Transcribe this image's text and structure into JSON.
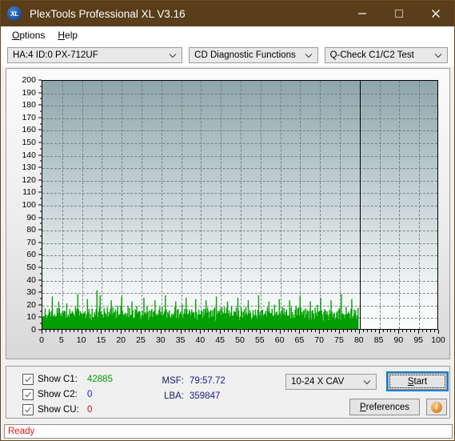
{
  "window": {
    "title": "PlexTools Professional XL V3.16",
    "icon": "XL",
    "icon_name": "plextools-logo-icon",
    "titlebar_color": "#5a3d1a",
    "controls": {
      "minimize": "minimize-icon",
      "maximize": "maximize-icon",
      "close": "close-icon"
    }
  },
  "menubar": {
    "items": [
      {
        "label": "Options",
        "accel": "O"
      },
      {
        "label": "Help",
        "accel": "H"
      }
    ]
  },
  "selectors": {
    "drive": {
      "value": "HA:4 ID:0  PX-712UF"
    },
    "function": {
      "value": "CD Diagnostic Functions"
    },
    "test": {
      "value": "Q-Check C1/C2 Test"
    }
  },
  "chart_data": {
    "type": "area",
    "title": "",
    "xlabel": "",
    "ylabel": "",
    "xlim": [
      0,
      100
    ],
    "ylim": [
      0,
      200
    ],
    "xticks": [
      0,
      5,
      10,
      15,
      20,
      25,
      30,
      35,
      40,
      45,
      50,
      55,
      60,
      65,
      70,
      75,
      80,
      85,
      90,
      95,
      100
    ],
    "yticks": [
      0,
      10,
      20,
      30,
      40,
      50,
      60,
      70,
      80,
      90,
      100,
      110,
      120,
      130,
      140,
      150,
      160,
      170,
      180,
      190,
      200
    ],
    "grid": true,
    "legend": null,
    "data_end_x": 80,
    "series": [
      {
        "name": "C1",
        "color": "#00a000",
        "baseline": 0,
        "x_start": 0,
        "x_end": 80,
        "y_mean": 14,
        "y_min": 6,
        "y_max": 31,
        "values": [
          8,
          11,
          9,
          13,
          10,
          7,
          12,
          9,
          14,
          11,
          8,
          15,
          10,
          12,
          9,
          13,
          11,
          8,
          14,
          10,
          12,
          16,
          9,
          13,
          11,
          15,
          10,
          12,
          14,
          9,
          18,
          11,
          13,
          10,
          16,
          12,
          9,
          14,
          11,
          13,
          10,
          15,
          12,
          17,
          11,
          13,
          9,
          16,
          12,
          14,
          10,
          13,
          11,
          15,
          9,
          12,
          14,
          10,
          16,
          11,
          13,
          9,
          15,
          12,
          10,
          14,
          11,
          17,
          12,
          9,
          13,
          15,
          10,
          12,
          14,
          11,
          9,
          16,
          12,
          13,
          10,
          14,
          11,
          13,
          9,
          15,
          12,
          10,
          16,
          13,
          11,
          14,
          9,
          12,
          15,
          10,
          13,
          11,
          17,
          12,
          14,
          10,
          13,
          9,
          15,
          11,
          12,
          16,
          10,
          14,
          12,
          9,
          13,
          15,
          11,
          10,
          14,
          12,
          16,
          9,
          13,
          11,
          15,
          10,
          12,
          14,
          9,
          16,
          11,
          13,
          10,
          15,
          12,
          9,
          14,
          11,
          13,
          16,
          10,
          12,
          15,
          9,
          13,
          11,
          14,
          10,
          12,
          16,
          13,
          9,
          15,
          11,
          12,
          14,
          10,
          13,
          9,
          16,
          11,
          15,
          12,
          10,
          14,
          13,
          9,
          11,
          16,
          12,
          10,
          15,
          13,
          9,
          14,
          11,
          12,
          16,
          10,
          13,
          15,
          9,
          11,
          14,
          12,
          10,
          16,
          13,
          9,
          15,
          11,
          12,
          14,
          10,
          13,
          16,
          9,
          11,
          15,
          12,
          10,
          14,
          13,
          9,
          16,
          11,
          15,
          12,
          10,
          14,
          13,
          9,
          11,
          16,
          12,
          15,
          10,
          13,
          14,
          9,
          11,
          12,
          16,
          10,
          15,
          13,
          9,
          14,
          11,
          12,
          16,
          10,
          13,
          15,
          9,
          11,
          14,
          12,
          10,
          16,
          13,
          9,
          15,
          11,
          12,
          14,
          10,
          13,
          16,
          9,
          11,
          15,
          12,
          10,
          14,
          13,
          9,
          16,
          11,
          12,
          15,
          10,
          13,
          14,
          9,
          11,
          16,
          12,
          10,
          15,
          13,
          9,
          14,
          11,
          12,
          16,
          10,
          13,
          15,
          9,
          11,
          14,
          12,
          10,
          16,
          13,
          9,
          15,
          11,
          12,
          14,
          10,
          13,
          16,
          9,
          11,
          15,
          12,
          10,
          14,
          13,
          9,
          11,
          16,
          12,
          15,
          10,
          13,
          14,
          9,
          11,
          12,
          16,
          10,
          15,
          13,
          9,
          14,
          11,
          12,
          16,
          10,
          13,
          15,
          9,
          11,
          14,
          12,
          10,
          16,
          13,
          9,
          15,
          11,
          12,
          14,
          10,
          13,
          16,
          9,
          11,
          15,
          12,
          10,
          14,
          13,
          9,
          16,
          11,
          12,
          15,
          10,
          13,
          14,
          9,
          11,
          16,
          12,
          10,
          15,
          13,
          9,
          14,
          11,
          12,
          16,
          10,
          13,
          15,
          9,
          11,
          14,
          12,
          10,
          16,
          13,
          9,
          15,
          11,
          12,
          14,
          10,
          13,
          16,
          9,
          11,
          15,
          12,
          10,
          14,
          13,
          9,
          11,
          16,
          12,
          15,
          10,
          13,
          14,
          9,
          11,
          12
        ],
        "spikes": [
          {
            "x": 2.4,
            "y": 26
          },
          {
            "x": 4.1,
            "y": 22
          },
          {
            "x": 8.9,
            "y": 28
          },
          {
            "x": 11.2,
            "y": 24
          },
          {
            "x": 13.8,
            "y": 31
          },
          {
            "x": 14.6,
            "y": 27
          },
          {
            "x": 17.3,
            "y": 23
          },
          {
            "x": 19.9,
            "y": 26
          },
          {
            "x": 22.5,
            "y": 22
          },
          {
            "x": 25.7,
            "y": 25
          },
          {
            "x": 28.4,
            "y": 23
          },
          {
            "x": 31.1,
            "y": 27
          },
          {
            "x": 33.6,
            "y": 22
          },
          {
            "x": 36.2,
            "y": 25
          },
          {
            "x": 38.8,
            "y": 24
          },
          {
            "x": 41.4,
            "y": 23
          },
          {
            "x": 44.0,
            "y": 26
          },
          {
            "x": 46.7,
            "y": 22
          },
          {
            "x": 49.3,
            "y": 25
          },
          {
            "x": 52.0,
            "y": 23
          },
          {
            "x": 54.6,
            "y": 27
          },
          {
            "x": 57.2,
            "y": 22
          },
          {
            "x": 59.8,
            "y": 24
          },
          {
            "x": 62.5,
            "y": 23
          },
          {
            "x": 65.1,
            "y": 26
          },
          {
            "x": 67.7,
            "y": 22
          },
          {
            "x": 70.4,
            "y": 25
          },
          {
            "x": 73.0,
            "y": 23
          },
          {
            "x": 75.6,
            "y": 28
          },
          {
            "x": 78.2,
            "y": 24
          }
        ]
      }
    ]
  },
  "controls": {
    "checks": [
      {
        "label": "Show C1:",
        "value": "42885",
        "color": "#00a000",
        "checked": true,
        "name": "show-c1"
      },
      {
        "label": "Show C2:",
        "value": "0",
        "color": "#1a1acc",
        "checked": true,
        "name": "show-c2"
      },
      {
        "label": "Show CU:",
        "value": "0",
        "color": "#d01010",
        "checked": true,
        "name": "show-cu"
      }
    ],
    "readouts": [
      {
        "key": "MSF:",
        "value": "79:57.72"
      },
      {
        "key": "LBA:",
        "value": "359847"
      }
    ],
    "speed": {
      "value": "10-24 X CAV"
    },
    "start": {
      "label": "Start",
      "accel": "S"
    },
    "preferences": {
      "label": "Preferences",
      "accel": "P"
    },
    "info": {
      "glyph": "i"
    }
  },
  "status": {
    "text": "Ready",
    "color": "#e01414"
  }
}
